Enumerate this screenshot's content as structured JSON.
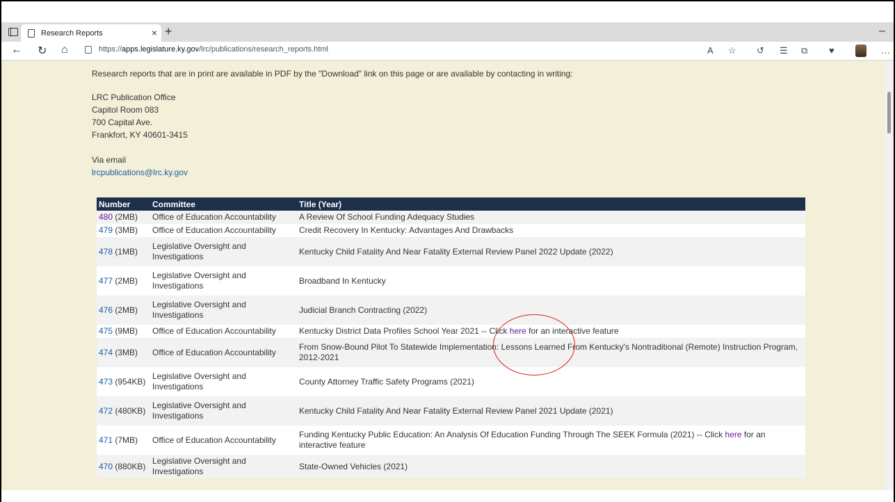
{
  "browser": {
    "tab_title": "Research Reports",
    "url_prefix": "https://",
    "url_domain": "apps.legislature.ky.gov",
    "url_path": "/lrc/publications/research_reports.html"
  },
  "page": {
    "intro": "Research reports that are in print are available in PDF by the \"Download\" link on this page or are available by contacting in writing:",
    "address": [
      "LRC Publication Office",
      "Capitol Room 083",
      "700 Capital Ave.",
      "Frankfort, KY 40601-3415"
    ],
    "via_email": "Via email",
    "email": "lrcpublications@lrc.ky.gov"
  },
  "table": {
    "headers": [
      "Number",
      "Committee",
      "Title (Year)"
    ],
    "rows": [
      {
        "num": "480",
        "size": " (2MB)",
        "committee": "Office of Education Accountability",
        "title": "A Review Of School Funding Adequacy Studies",
        "title_link": "",
        "title_after": ""
      },
      {
        "num": "479",
        "size": " (3MB)",
        "committee": "Office of Education Accountability",
        "title": "Credit Recovery In Kentucky: Advantages And Drawbacks",
        "title_link": "",
        "title_after": ""
      },
      {
        "num": "478",
        "size": " (1MB)",
        "committee": "Legislative Oversight and Investigations",
        "title": "Kentucky Child Fatality And Near Fatality External Review Panel 2022 Update (2022)",
        "title_link": "",
        "title_after": ""
      },
      {
        "num": "477",
        "size": " (2MB)",
        "committee": "Legislative Oversight and Investigations",
        "title": "Broadband In Kentucky",
        "title_link": "",
        "title_after": ""
      },
      {
        "num": "476",
        "size": " (2MB)",
        "committee": "Legislative Oversight and Investigations",
        "title": "Judicial Branch Contracting (2022)",
        "title_link": "",
        "title_after": ""
      },
      {
        "num": "475",
        "size": " (9MB)",
        "committee": "Office of Education Accountability",
        "title": "Kentucky District Data Profiles School Year 2021 -- Click ",
        "title_link": "here",
        "title_after": " for an interactive feature"
      },
      {
        "num": "474",
        "size": " (3MB)",
        "committee": "Office of Education Accountability",
        "title": "From Snow-Bound Pilot To Statewide Implementation: Lessons Learned From Kentucky's Nontraditional (Remote) Instruction Program, 2012-2021",
        "title_link": "",
        "title_after": ""
      },
      {
        "num": "473",
        "size": " (954KB)",
        "committee": "Legislative Oversight and Investigations",
        "title": "County Attorney Traffic Safety Programs (2021)",
        "title_link": "",
        "title_after": ""
      },
      {
        "num": "472",
        "size": " (480KB)",
        "committee": "Legislative Oversight and Investigations",
        "title": "Kentucky Child Fatality And Near Fatality External Review Panel 2021 Update (2021)",
        "title_link": "",
        "title_after": ""
      },
      {
        "num": "471",
        "size": " (7MB)",
        "committee": "Office of Education Accountability",
        "title": "Funding Kentucky Public Education: An Analysis Of Education Funding Through The SEEK Formula (2021) -- Click ",
        "title_link": "here",
        "title_after": " for an interactive feature"
      },
      {
        "num": "470",
        "size": " (880KB)",
        "committee": "Legislative Oversight and Investigations",
        "title": "State-Owned Vehicles (2021)",
        "title_link": "",
        "title_after": ""
      }
    ]
  }
}
